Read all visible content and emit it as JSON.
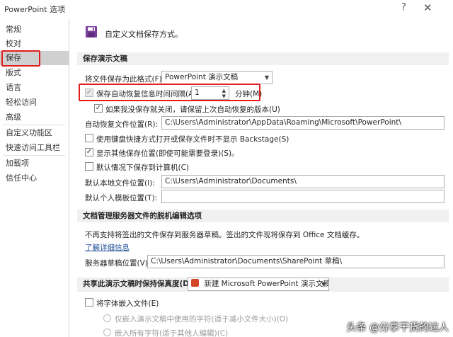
{
  "window": {
    "title": "PowerPoint 选项",
    "help": "?",
    "close": "✕"
  },
  "sidebar": {
    "items": [
      {
        "label": "常规"
      },
      {
        "label": "校对"
      },
      {
        "label": "保存"
      },
      {
        "label": "版式"
      },
      {
        "label": "语言"
      },
      {
        "label": "轻松访问"
      },
      {
        "label": "高级"
      },
      {
        "label": "自定义功能区"
      },
      {
        "label": "快速访问工具栏"
      },
      {
        "label": "加载项"
      },
      {
        "label": "信任中心"
      }
    ],
    "active": "保存"
  },
  "header": {
    "text": "自定义文档保存方式。",
    "icon": "save-icon"
  },
  "sections": {
    "save_presentations": {
      "title": "保存演示文稿",
      "format_label": "将文件保存为此格式(F):",
      "format_value": "PowerPoint 演示文稿",
      "autorecover_label": "保存自动恢复信息时间间隔(A)",
      "autorecover_checked": true,
      "autorecover_minutes": "1",
      "minutes_label": "分钟(M)",
      "keep_last_label": "如果我没保存就关闭，请保留上次自动恢复的版本(U)",
      "keep_last_checked": true,
      "autorecover_location_label": "自动恢复文件位置(R):",
      "autorecover_location_value": "C:\\Users\\Administrator\\AppData\\Roaming\\Microsoft\\PowerPoint\\",
      "no_backstage_label": "使用键盘快捷方式打开或保存文件时不显示 Backstage(S)",
      "no_backstage_checked": false,
      "show_locations_label": "显示其他保存位置(即使可能需要登录)(S)。",
      "show_locations_checked": true,
      "save_to_computer_label": "默认情况下保存到计算机(C)",
      "save_to_computer_checked": false,
      "default_local_label": "默认本地文件位置(I):",
      "default_local_value": "C:\\Users\\Administrator\\Documents\\",
      "personal_templates_label": "默认个人模板位置(T):",
      "personal_templates_value": ""
    },
    "offline_editing": {
      "title": "文档管理服务器文件的脱机编辑选项",
      "note": "不再支持将签出的文件保存到服务器草稿。签出的文件现将保存到 Office 文档缓存。",
      "learn_more": "了解详细信息",
      "drafts_label": "服务器草稿位置(V):",
      "drafts_value": "C:\\Users\\Administrator\\Documents\\SharePoint 草稿\\"
    },
    "fidelity": {
      "title": "共享此演示文稿时保持保真度(D):",
      "presentation_value": "新建 Microsoft PowerPoint 演示文稿",
      "embed_fonts_label": "将字体嵌入文件(E)",
      "embed_fonts_checked": false,
      "embed_only_used_label": "仅嵌入演示文稿中使用的字符(适于减小文件大小)(O)",
      "embed_all_label": "嵌入所有字符(适于其他人编辑)(C)"
    }
  },
  "watermark": "头条 @分享干货的达人",
  "colors": {
    "highlight_red": "#e0201e",
    "section_bg": "#f0f0f0",
    "active_bg": "#d0d0d0",
    "link": "#1f4f99"
  }
}
